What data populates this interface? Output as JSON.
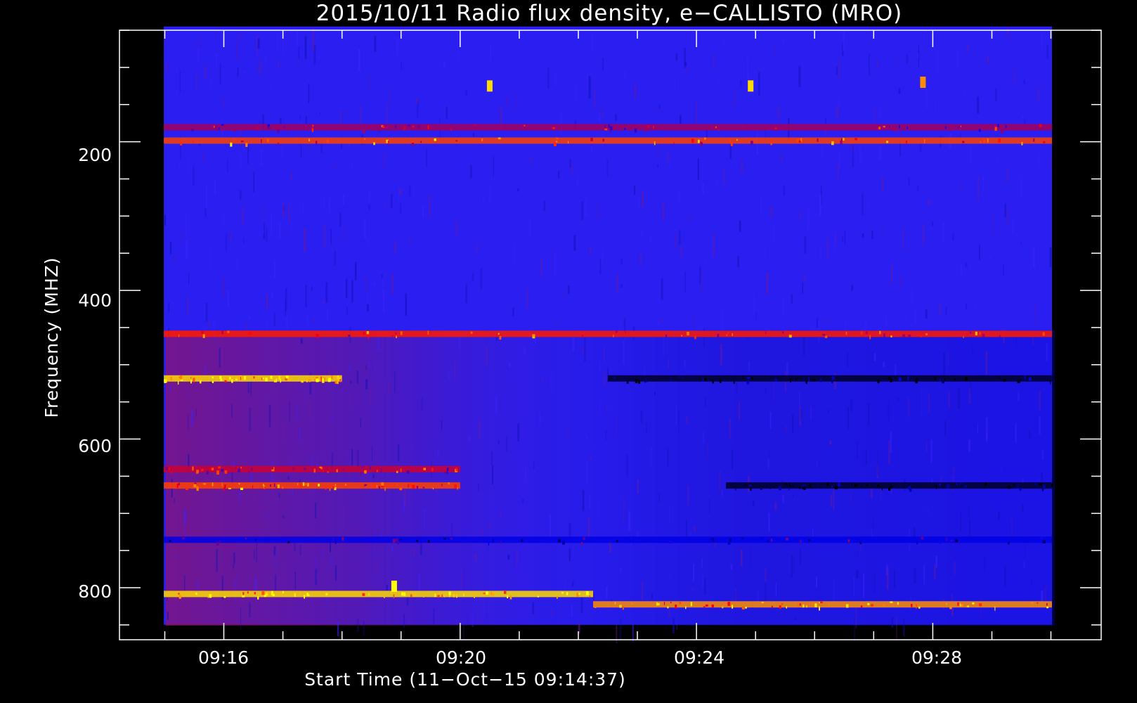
{
  "chart_data": {
    "type": "heatmap",
    "title": "2015/10/11  Radio flux density, e−CALLISTO (MRO)",
    "xlabel": "Start Time (11−Oct−15 09:14:37)",
    "ylabel": "Frequency (MHZ)",
    "x_ticks": [
      "09:16",
      "09:20",
      "09:24",
      "09:28"
    ],
    "y_ticks": [
      "200",
      "400",
      "600",
      "800"
    ],
    "x_start": "09:14:37",
    "x_range": [
      "09:14:14",
      "09:30:51"
    ],
    "y_range": [
      50,
      870
    ],
    "y_inverted": true,
    "data_x_range": [
      "09:14:59",
      "09:30:01"
    ],
    "data_y_range": [
      45,
      850
    ],
    "colormap": [
      "#000000",
      "#0000ff",
      "#ff0000",
      "#ffff00"
    ],
    "background_color": "#2a1ef0",
    "features": [
      {
        "type": "band",
        "freq": 180,
        "t0": "09:14:59",
        "t1": "09:30:01",
        "intensity": 0.55
      },
      {
        "type": "band",
        "freq": 198,
        "t0": "09:14:59",
        "t1": "09:30:01",
        "intensity": 0.75
      },
      {
        "type": "band",
        "freq": 458,
        "t0": "09:14:59",
        "t1": "09:30:01",
        "intensity": 0.7
      },
      {
        "type": "band",
        "freq": 518,
        "t0": "09:14:59",
        "t1": "09:18:00",
        "intensity": 0.95
      },
      {
        "type": "band",
        "freq": 518,
        "t0": "09:22:30",
        "t1": "09:30:01",
        "intensity": 0.05
      },
      {
        "type": "band",
        "freq": 640,
        "t0": "09:14:59",
        "t1": "09:20:00",
        "intensity": 0.6
      },
      {
        "type": "band",
        "freq": 662,
        "t0": "09:14:59",
        "t1": "09:20:00",
        "intensity": 0.75
      },
      {
        "type": "band",
        "freq": 662,
        "t0": "09:24:30",
        "t1": "09:30:01",
        "intensity": 0.05
      },
      {
        "type": "band",
        "freq": 735,
        "t0": "09:14:59",
        "t1": "09:30:01",
        "intensity": 0.3
      },
      {
        "type": "band",
        "freq": 808,
        "t0": "09:14:59",
        "t1": "09:22:15",
        "intensity": 0.95
      },
      {
        "type": "band",
        "freq": 822,
        "t0": "09:22:15",
        "t1": "09:30:01",
        "intensity": 0.85
      },
      {
        "type": "burst",
        "freq": 125,
        "t": "09:20:30",
        "intensity": 0.95
      },
      {
        "type": "burst",
        "freq": 125,
        "t": "09:24:55",
        "intensity": 0.95
      },
      {
        "type": "burst",
        "freq": 120,
        "t": "09:27:50",
        "intensity": 0.85
      },
      {
        "type": "burst",
        "freq": 798,
        "t": "09:18:53",
        "intensity": 1.0
      }
    ]
  }
}
